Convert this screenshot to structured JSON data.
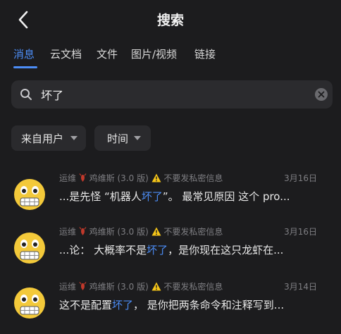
{
  "header": {
    "title": "搜索"
  },
  "tabs": [
    {
      "label": "消息",
      "active": true
    },
    {
      "label": "云文档"
    },
    {
      "label": "文件"
    },
    {
      "label": "图片/视频"
    },
    {
      "label": "链接"
    }
  ],
  "search": {
    "value": "坏了"
  },
  "filters": [
    {
      "label": "来自用户"
    },
    {
      "label": "时间"
    }
  ],
  "results": [
    {
      "sender": "运维",
      "bot": "鸡维斯 (3.0 版)",
      "warning": "不要发私密信息",
      "date": "3月16日",
      "snippet_pre": "...是先怪 “机器人",
      "snippet_hl": "坏了",
      "snippet_post": "”。 最常见原因 这个 pro..."
    },
    {
      "sender": "运维",
      "bot": "鸡维斯 (3.0 版)",
      "warning": "不要发私密信息",
      "date": "3月16日",
      "snippet_pre": "...论： 大概率不是",
      "snippet_hl": "坏了",
      "snippet_post": "，是你现在这只龙虾在..."
    },
    {
      "sender": "运维",
      "bot": "鸡维斯 (3.0 版)",
      "warning": "不要发私密信息",
      "date": "3月14日",
      "snippet_pre": "这不是配置",
      "snippet_hl": "坏了",
      "snippet_post": "， 是你把两条命令和注释写到..."
    }
  ],
  "colors": {
    "accent": "#4c8df6",
    "background": "#1c1c1e",
    "lobster": "#c0392b",
    "warning": "#f5c518"
  }
}
